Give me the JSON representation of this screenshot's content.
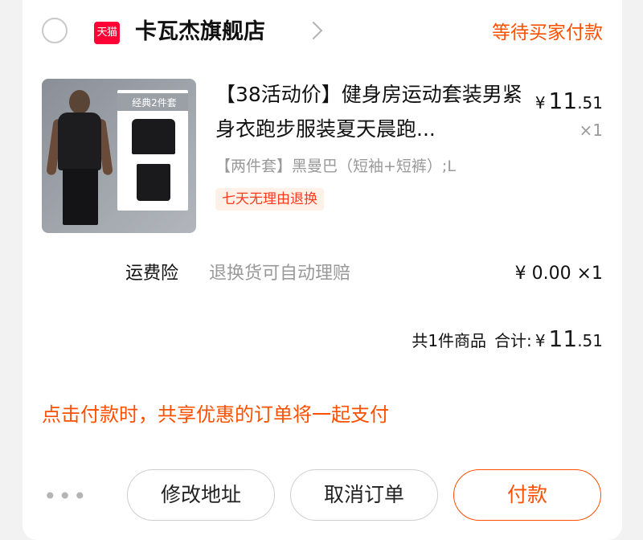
{
  "shop": {
    "badge": "天猫",
    "name": "卡瓦杰旗舰店",
    "status": "等待买家付款"
  },
  "product": {
    "thumb_label": "经典2件套",
    "title": "【38活动价】健身房运动套装男紧身衣跑步服装夏天晨跑...",
    "sku": "【两件套】黑曼巴（短袖+短裤）;L",
    "tag": "七天无理由退换",
    "price_yen": "¥",
    "price_int": "11",
    "price_dec": ".51",
    "quantity": "×1"
  },
  "insurance": {
    "label": "运费险",
    "description": "退换货可自动理赔",
    "price": "¥ 0.00 ×1"
  },
  "total": {
    "count_text": "共1件商品",
    "label": "合计:",
    "yen": "¥",
    "int": "11",
    "dec": ".51"
  },
  "notice": "点击付款时，共享优惠的订单将一起支付",
  "actions": {
    "more": "•••",
    "modify_address": "修改地址",
    "cancel_order": "取消订单",
    "pay": "付款"
  },
  "colors": {
    "accent": "#ff5000",
    "tmall_red": "#ff0036",
    "muted": "#999999"
  }
}
